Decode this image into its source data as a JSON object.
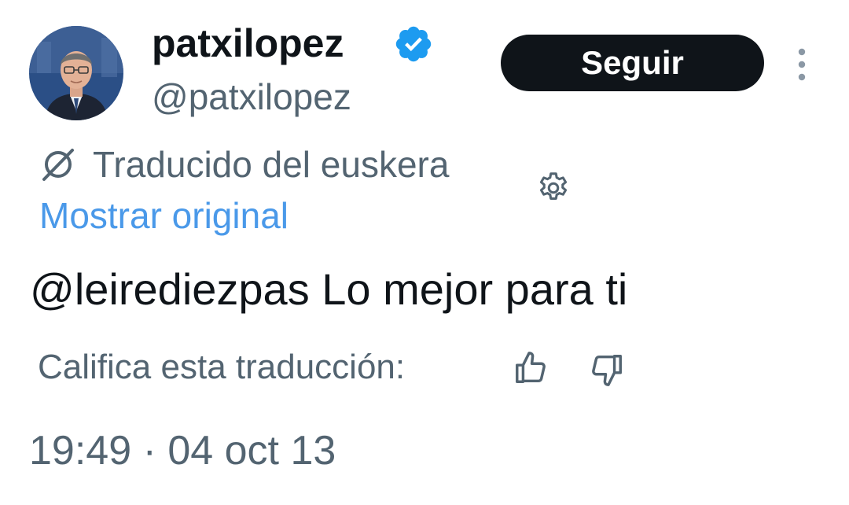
{
  "author": {
    "display_name": "patxilopez",
    "handle": "@patxilopez",
    "verified_icon": "verified-badge-icon",
    "avatar_icon": "avatar-photo"
  },
  "follow_button": {
    "label": "Seguir"
  },
  "more_menu": {
    "icon": "more-vertical-icon"
  },
  "translation": {
    "icon": "translate-icon",
    "notice": "Traducido del euskera",
    "show_original": "Mostrar original",
    "settings_icon": "gear-icon"
  },
  "tweet": {
    "text": "@leirediezpas Lo mejor para ti"
  },
  "rating": {
    "label": "Califica esta traducción:",
    "up_icon": "thumbs-up-icon",
    "down_icon": "thumbs-down-icon"
  },
  "meta": {
    "timestamp": "19:49 · 04 oct 13"
  },
  "colors": {
    "text_primary": "#0f1419",
    "text_secondary": "#536471",
    "link": "#4a99e9",
    "verified": "#1d9bf0",
    "button_bg": "#0f1419",
    "button_text": "#ffffff"
  }
}
